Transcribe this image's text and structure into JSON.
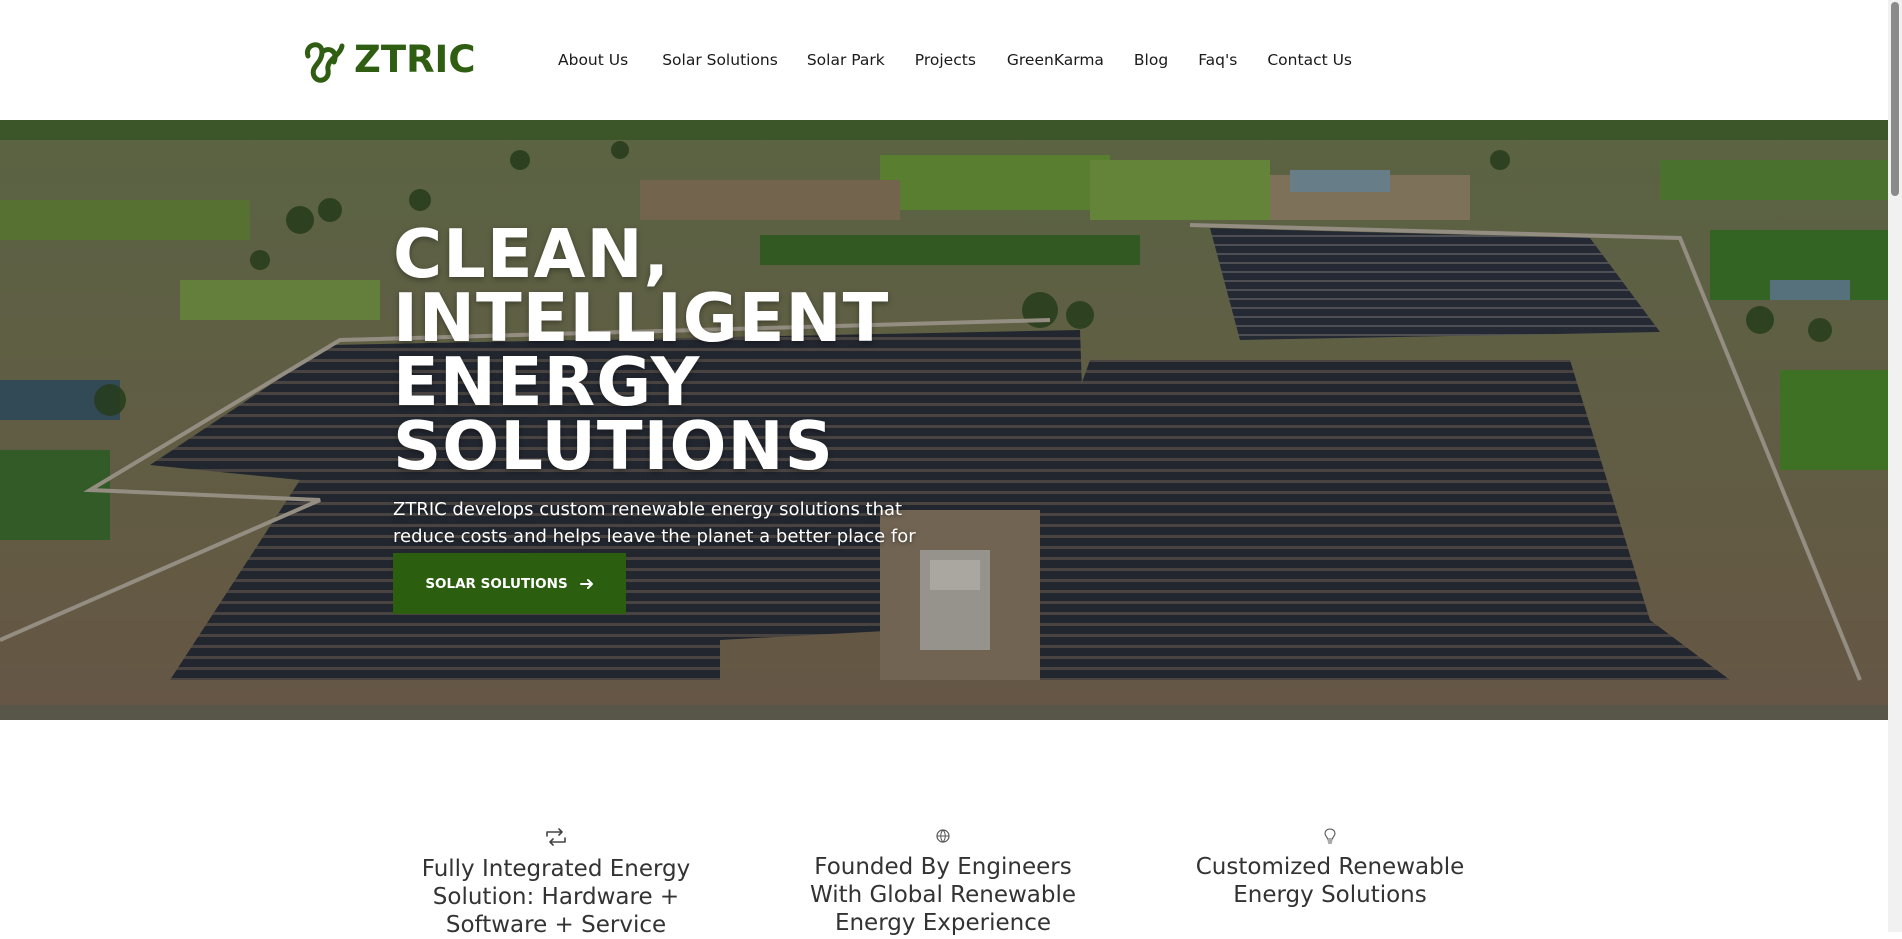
{
  "header": {
    "logo_text": "ZTRIC",
    "nav": [
      {
        "label": "About Us"
      },
      {
        "label": "Solar Solutions"
      },
      {
        "label": "Solar Park"
      },
      {
        "label": "Projects"
      },
      {
        "label": "GreenKarma"
      },
      {
        "label": "Blog"
      },
      {
        "label": "Faq's"
      },
      {
        "label": "Contact Us"
      }
    ]
  },
  "hero": {
    "title_lines": [
      "CLEAN,",
      "INTELLIGENT",
      "ENERGY SOLUTIONS"
    ],
    "description": "ZTRIC develops custom renewable energy solutions that reduce costs and helps leave the planet a better place for future generations.",
    "button_label": "SOLAR SOLUTIONS",
    "button_icon": "arrow-right-icon"
  },
  "features": [
    {
      "icon": "refresh-icon",
      "title": "Fully Integrated Energy Solution: Hardware + Software + Service"
    },
    {
      "icon": "globe-icon",
      "title": "Founded By Engineers With Global Renewable Energy Experience"
    },
    {
      "icon": "lightbulb-icon",
      "title": "Customized Renewable Energy Solutions"
    }
  ],
  "colors": {
    "brand_green": "#2f5e12",
    "button_green": "#2c5e0f",
    "text_dark": "#1a1a1a",
    "feature_text": "#333333"
  }
}
